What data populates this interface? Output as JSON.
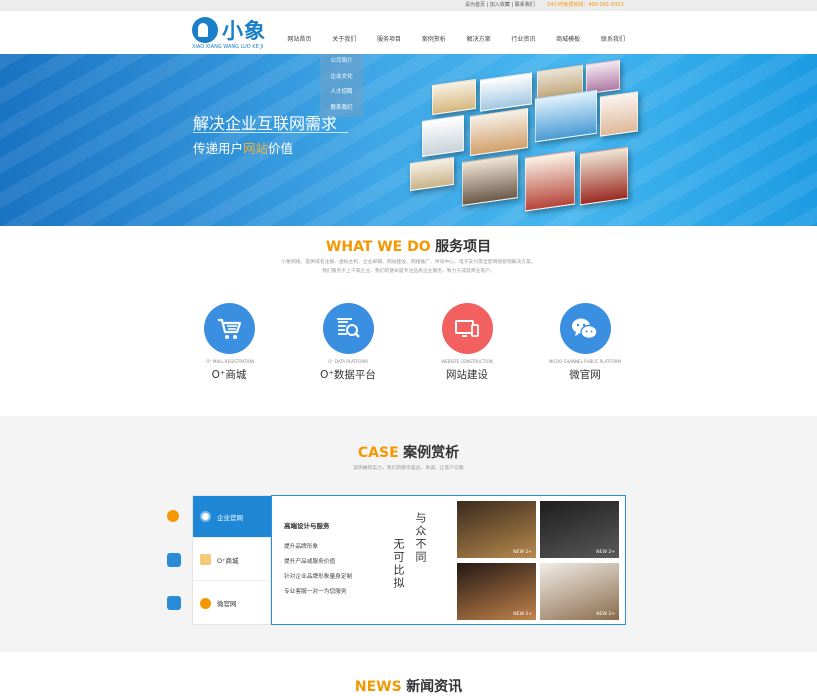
{
  "topbar": {
    "links": [
      "设为首页",
      "加入收藏",
      "联系我们"
    ],
    "hotline": "24小时免费热线：400-001-0312"
  },
  "logo": {
    "name": "小象",
    "pinyin": "XIAO XIANG WANG LUO KE JI"
  },
  "nav": [
    "网站首页",
    "关于我们",
    "服务项目",
    "案例赏析",
    "解决方案",
    "行业资讯",
    "商城模板",
    "联系我们"
  ],
  "dropdown": [
    "公司简介",
    "企业文化",
    "人才招聘",
    "联系我们"
  ],
  "hero": {
    "line1": "解决企业互联网需求",
    "line2_pre": "传递用户",
    "line2_hl": "网站",
    "line2_post": "价值"
  },
  "services": {
    "title_en": "WHAT WE DO",
    "title_cn": "服务项目",
    "intro1": "小象网络，提供域名注册、虚拟主机、企业邮箱、网站建设、网络推广、呼叫中心、电子支付等全套网络营销解决方案。",
    "intro2": "我们服务于上千家企业，我们的使命是专注品质企业服务，致力于成就商业客户。",
    "items": [
      {
        "sub": "· O⁺ MALL REGISTRATION",
        "title": "O⁺商城",
        "color": "#3b8fe0",
        "icon": "cart-icon"
      },
      {
        "sub": "O⁺ DATA PLATFORM",
        "title": "O⁺数据平台",
        "color": "#3b8fe0",
        "icon": "data-search-icon"
      },
      {
        "sub": "WEBSITE CONSTRUCTION",
        "title": "网站建设",
        "color": "#f26060",
        "icon": "devices-icon"
      },
      {
        "sub": "MICRO CHANNEL PUBLIC PLATFORM",
        "title": "微官网",
        "color": "#3b8fe0",
        "icon": "wechat-icon"
      }
    ]
  },
  "cases": {
    "title_en": "CASE",
    "title_cn": "案例赏析",
    "intro": "案例展现实力，我们的服务是品、真诚、让客户信赖",
    "tabs": [
      {
        "label": "企业官网",
        "icon": "website-icon"
      },
      {
        "label": "O⁺商城",
        "icon": "cart-icon"
      },
      {
        "label": "微官网",
        "icon": "wechat-icon"
      }
    ],
    "panel": {
      "heading": "高端设计与服务",
      "lines": [
        "提升品牌形象",
        "提升产品或服务价值",
        "针对企业品牌形象量身定制",
        "专业客服一对一为您服务"
      ],
      "callig_right": "与众不同",
      "callig_left": "无可比拟"
    },
    "thumbs": [
      {
        "badge": "NEW 2+",
        "colors": [
          "#3a2a1c",
          "#b78a4e"
        ]
      },
      {
        "badge": "NEW 2+",
        "colors": [
          "#1d1d1d",
          "#5a5a5a"
        ]
      },
      {
        "badge": "NEW 2+",
        "colors": [
          "#241814",
          "#c2844c"
        ]
      },
      {
        "badge": "NEW 2+",
        "colors": [
          "#f1ede6",
          "#8a6b4b"
        ]
      }
    ]
  },
  "news": {
    "title_en": "NEWS",
    "title_cn": "新闻资讯"
  },
  "colors": {
    "accent": "#f39800",
    "brand": "#1a7fc9",
    "tab_active": "#1e88d6"
  }
}
